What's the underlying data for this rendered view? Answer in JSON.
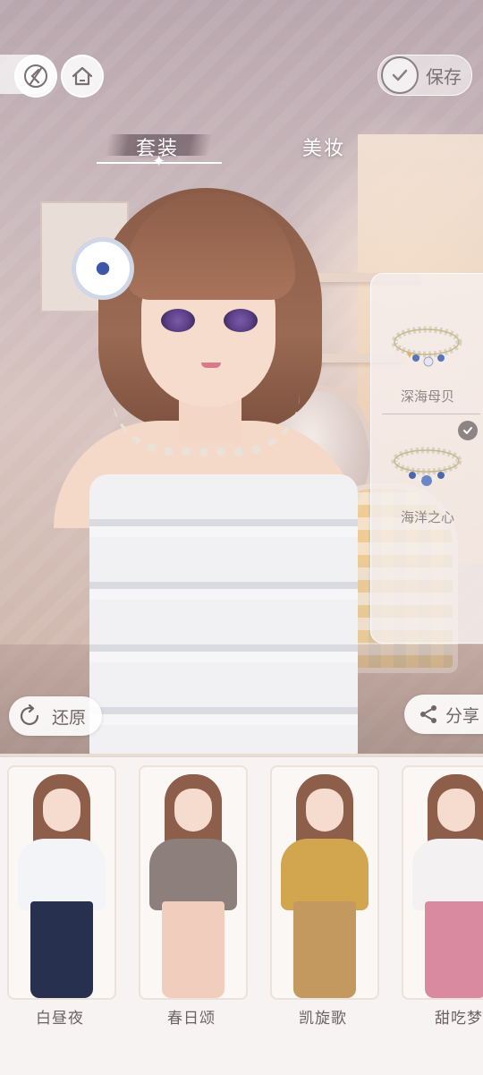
{
  "topbar": {
    "save_label": "保存"
  },
  "tabs": [
    {
      "label": "套装",
      "active": true
    },
    {
      "label": "美妆",
      "active": false
    }
  ],
  "accessory_panel": {
    "items": [
      {
        "label": "深海母贝",
        "selected": false
      },
      {
        "label": "海洋之心",
        "selected": true
      }
    ]
  },
  "actions": {
    "restore_label": "还原",
    "share_label": "分享"
  },
  "outfits": [
    {
      "label": "白昼夜",
      "top_color": "#f3f4f7",
      "bottom_color": "#27304f",
      "accent": "#7fb7d8"
    },
    {
      "label": "春日颂",
      "top_color": "#8d7f7c",
      "bottom_color": "#f0cdbd",
      "accent": "#e9b3a8"
    },
    {
      "label": "凯旋歌",
      "top_color": "#d2a64e",
      "bottom_color": "#c3995f",
      "accent": "#f3e9df"
    },
    {
      "label": "甜吃梦",
      "top_color": "#f4f1f2",
      "bottom_color": "#d98aa0",
      "accent": "#3f6a9a"
    }
  ],
  "colors": {
    "panel_text": "#8f8586",
    "button_text": "#6f6568",
    "tab_text": "#ffffff"
  }
}
